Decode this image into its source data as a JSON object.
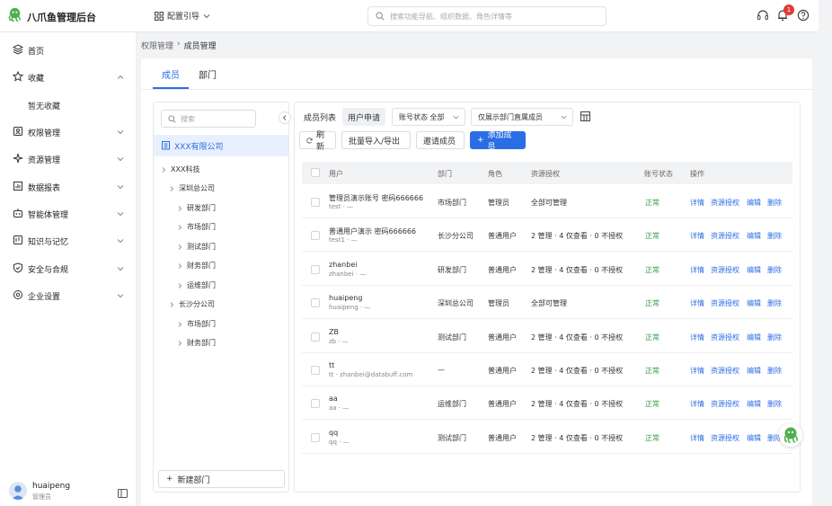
{
  "app": {
    "brand": "八爪鱼管理后台",
    "guide_label": "配置引导",
    "search_placeholder": "搜索功能导航、组织数据、角色详情等",
    "notification_count": "1"
  },
  "sidebar": {
    "items": [
      {
        "label": "首页",
        "icon": "layers-icon"
      },
      {
        "label": "收藏",
        "icon": "star-icon"
      },
      {
        "label": "暂无收藏",
        "icon": ""
      },
      {
        "label": "权限管理",
        "icon": "permission-icon"
      },
      {
        "label": "资源管理",
        "icon": "resource-icon"
      },
      {
        "label": "数据报表",
        "icon": "chart-icon"
      },
      {
        "label": "智能体管理",
        "icon": "robot-icon"
      },
      {
        "label": "知识与记忆",
        "icon": "knowledge-icon"
      },
      {
        "label": "安全与合规",
        "icon": "shield-icon"
      },
      {
        "label": "企业设置",
        "icon": "gear-icon"
      }
    ],
    "user": {
      "name": "huaipeng",
      "role": "管理员"
    }
  },
  "breadcrumb": {
    "parent": "权限管理",
    "separator": "›",
    "current": "成员管理"
  },
  "tabs": [
    {
      "label": "成员",
      "active": true
    },
    {
      "label": "部门",
      "active": false
    }
  ],
  "tree": {
    "search_placeholder": "搜索",
    "company": "XXX有限公司",
    "nodes": [
      {
        "label": "XXX科技",
        "level": 0
      },
      {
        "label": "深圳总公司",
        "level": 1
      },
      {
        "label": "研发部门",
        "level": 2
      },
      {
        "label": "市场部门",
        "level": 2
      },
      {
        "label": "测试部门",
        "level": 2
      },
      {
        "label": "财务部门",
        "level": 2
      },
      {
        "label": "运维部门",
        "level": 2
      },
      {
        "label": "长沙分公司",
        "level": 1
      },
      {
        "label": "市场部门",
        "level": 2
      },
      {
        "label": "财务部门",
        "level": 2
      }
    ],
    "new_dept_label": "新建部门"
  },
  "toolbar": {
    "segments": [
      "成员列表",
      "用户申请"
    ],
    "status_filter": "账号状态 全部",
    "scope_filter": "仅展示部门直属成员",
    "refresh": "刷新",
    "import_export": "批量导入/导出",
    "invite": "邀请成员",
    "add": "添加成员"
  },
  "table": {
    "columns": [
      "用户",
      "部门",
      "角色",
      "资源授权",
      "账号状态",
      "操作"
    ],
    "actions": [
      "详情",
      "资源授权",
      "编辑",
      "删除"
    ],
    "rows": [
      {
        "name": "管理员演示账号 密码666666",
        "sub": "test · —",
        "dept": "市场部门",
        "role": "管理员",
        "auth": "全部可管理",
        "status": "正常"
      },
      {
        "name": "普通用户演示 密码666666",
        "sub": "test1 · —",
        "dept": "长沙分公司",
        "role": "普通用户",
        "auth": "2 管理 · 4 仅查看 · 0 不授权",
        "status": "正常"
      },
      {
        "name": "zhanbei",
        "sub": "zhanbei · —",
        "dept": "研发部门",
        "role": "普通用户",
        "auth": "2 管理 · 4 仅查看 · 0 不授权",
        "status": "正常"
      },
      {
        "name": "huaipeng",
        "sub": "huaipeng · —",
        "dept": "深圳总公司",
        "role": "管理员",
        "auth": "全部可管理",
        "status": "正常"
      },
      {
        "name": "ZB",
        "sub": "zb · —",
        "dept": "测试部门",
        "role": "普通用户",
        "auth": "2 管理 · 4 仅查看 · 0 不授权",
        "status": "正常"
      },
      {
        "name": "tt",
        "sub": "tt · zhanbei@databuff.com",
        "dept": "—",
        "role": "普通用户",
        "auth": "2 管理 · 4 仅查看 · 0 不授权",
        "status": "正常"
      },
      {
        "name": "aa",
        "sub": "aa · —",
        "dept": "运维部门",
        "role": "普通用户",
        "auth": "2 管理 · 4 仅查看 · 0 不授权",
        "status": "正常"
      },
      {
        "name": "qq",
        "sub": "qq · —",
        "dept": "测试部门",
        "role": "普通用户",
        "auth": "2 管理 · 4 仅查看 · 0 不授权",
        "status": "正常"
      }
    ]
  },
  "colors": {
    "primary": "#2b6de5",
    "success": "#2f9e44",
    "danger_badge": "#e53935"
  }
}
